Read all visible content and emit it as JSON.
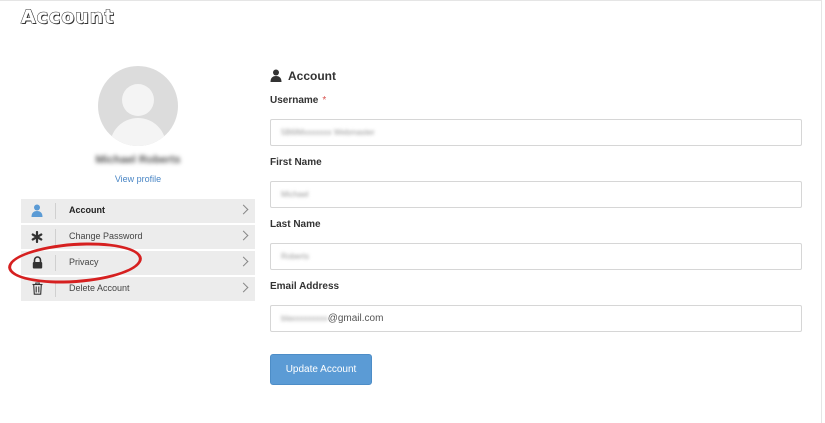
{
  "page": {
    "title": "Account"
  },
  "profile": {
    "name": "Michael Roberts",
    "view_profile_label": "View profile"
  },
  "menu": {
    "items": [
      {
        "label": "Account",
        "icon": "user-icon",
        "active": true
      },
      {
        "label": "Change Password",
        "icon": "asterisk-icon",
        "active": false
      },
      {
        "label": "Privacy",
        "icon": "lock-icon",
        "active": false
      },
      {
        "label": "Delete Account",
        "icon": "trash-icon",
        "active": false
      }
    ]
  },
  "form": {
    "section_title": "Account",
    "section_icon": "user-icon",
    "required_marker": "*",
    "fields": {
      "username": {
        "label": "Username",
        "value": "5B6lMxxxxxxx Webmaster"
      },
      "first_name": {
        "label": "First Name",
        "value": "Michael"
      },
      "last_name": {
        "label": "Last Name",
        "value": "Roberts"
      },
      "email": {
        "label": "Email Address",
        "value_local": "blaxxxxxxxxx",
        "value_domain": "@gmail.com"
      }
    },
    "submit_label": "Update Account"
  },
  "colors": {
    "accent": "#5b9bd5",
    "link": "#4a86c5",
    "annotation": "#d62020",
    "required": "#d9534f"
  }
}
